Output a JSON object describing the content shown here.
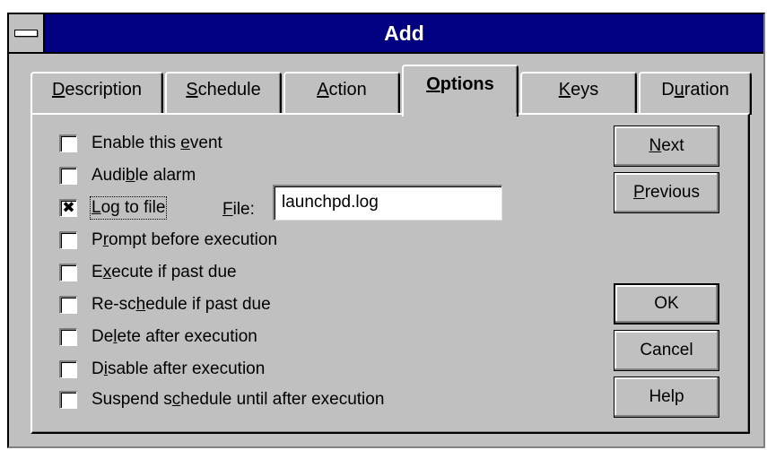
{
  "window": {
    "title": "Add"
  },
  "tabs": [
    {
      "label": "Description",
      "hotkey_index": 0,
      "active": false
    },
    {
      "label": "Schedule",
      "hotkey_index": 0,
      "active": false
    },
    {
      "label": "Action",
      "hotkey_index": 0,
      "active": false
    },
    {
      "label": "Options",
      "hotkey_index": 0,
      "active": true
    },
    {
      "label": "Keys",
      "hotkey_index": 0,
      "active": false
    },
    {
      "label": "Duration",
      "hotkey_index": 1,
      "active": false
    }
  ],
  "options": [
    {
      "label": "Enable this event",
      "checked": false,
      "hotkey_index": 12
    },
    {
      "label": "Audible alarm",
      "checked": false,
      "hotkey_index": 4
    },
    {
      "label": "Log to file",
      "checked": true,
      "hotkey_index": 0
    },
    {
      "label": "Prompt before execution",
      "checked": false,
      "hotkey_index": 1
    },
    {
      "label": "Execute if past due",
      "checked": false,
      "hotkey_index": 1
    },
    {
      "label": "Re-schedule if past due",
      "checked": false,
      "hotkey_index": 5
    },
    {
      "label": "Delete after execution",
      "checked": false,
      "hotkey_index": 2
    },
    {
      "label": "Disable after execution",
      "checked": false,
      "hotkey_index": 1
    },
    {
      "label": "Suspend schedule until after execution",
      "checked": false,
      "hotkey_index": 9
    }
  ],
  "file": {
    "label": "File:",
    "value": "launchpd.log"
  },
  "buttons": {
    "next": "Next",
    "previous": "Previous",
    "ok": "OK",
    "cancel": "Cancel",
    "help": "Help"
  },
  "colors": {
    "titlebar": "#000080",
    "face": "#c0c0c0"
  }
}
